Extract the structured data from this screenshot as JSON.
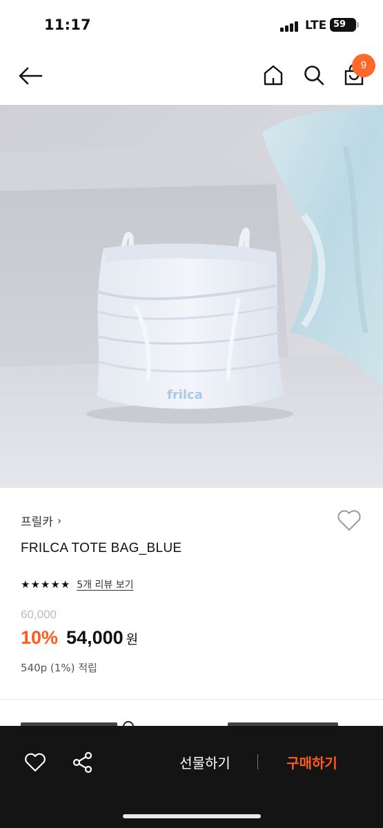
{
  "status_bar": {
    "time": "11:17",
    "network": "LTE",
    "battery": "59"
  },
  "nav": {
    "cart_count": "9",
    "icons": [
      "back-arrow-icon",
      "home-icon",
      "search-icon",
      "shopping-bag-icon"
    ]
  },
  "product": {
    "image_logo_text": "frilca",
    "brand": "프릴카",
    "brand_chevron": "›",
    "name": "FRILCA TOTE BAG_BLUE",
    "rating": 5,
    "rating_max": 5,
    "review_link": "5개 리뷰 보기",
    "original_price": "60,000",
    "discount": "10%",
    "sale_price": "54,000",
    "currency": "원",
    "points": "540p (1%) 적립"
  },
  "bottom_bar": {
    "gift_label": "선물하기",
    "buy_label": "구매하기"
  },
  "colors": {
    "accent": "#ff5a1f",
    "badge": "#ff6a2b",
    "bottom_bar_bg": "#141414"
  }
}
